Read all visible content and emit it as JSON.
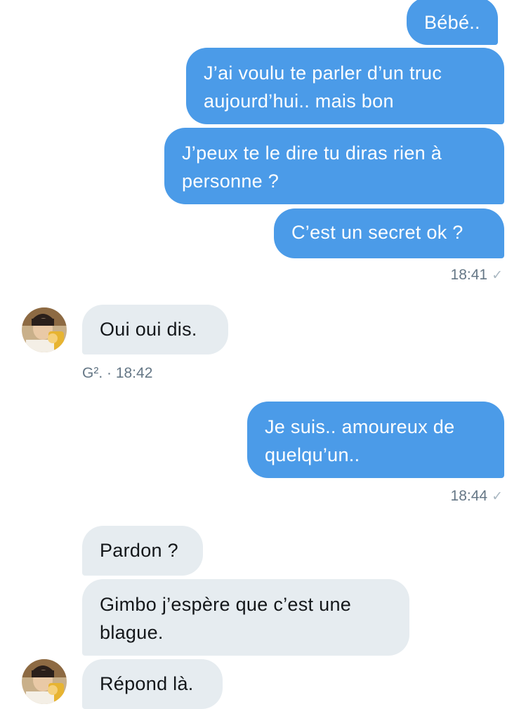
{
  "messages": {
    "m1": "Bébé..",
    "m2_l1": "J’ai voulu te parler d’un truc",
    "m2_l2": "aujourd’hui.. mais bon",
    "m3_l1": "J’peux te le dire tu diras rien à",
    "m3_l2": "personne ?",
    "m4": "C’est un secret ok ?",
    "time1": "18:41",
    "r1": "Oui oui dis.",
    "sender_meta": "G². · 18:42",
    "m5_l1": "Je suis.. amoureux de",
    "m5_l2": "quelqu’un..",
    "time2": "18:44",
    "r2": "Pardon ?",
    "r3_l1": "Gimbo j’espère que c’est une",
    "r3_l2": "blague.",
    "r4": "Répond là."
  },
  "colors": {
    "outgoing_bubble": "#4b9be8",
    "incoming_bubble": "#e6ecf0",
    "meta_text": "#657786"
  },
  "icons": {
    "read_receipt": "check-icon",
    "avatar": "avatar-photo"
  }
}
